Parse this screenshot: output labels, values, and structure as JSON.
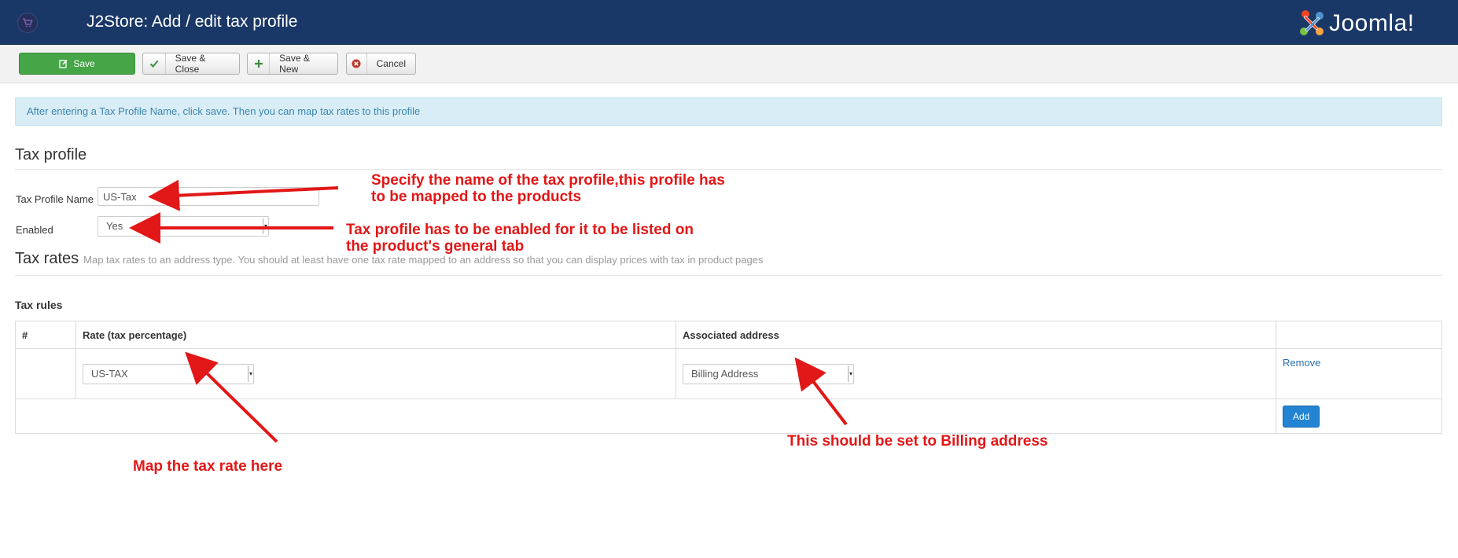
{
  "header": {
    "title": "J2Store: Add / edit tax profile",
    "brand": "Joomla!",
    "colors": {
      "background": "#1a3867",
      "text": "#ffffff"
    }
  },
  "toolbar": {
    "save_label": "Save",
    "save_close_label": "Save & Close",
    "save_new_label": "Save & New",
    "cancel_label": "Cancel"
  },
  "alert": {
    "text": "After entering a Tax Profile Name, click save. Then you can map tax rates to this profile"
  },
  "tax_profile": {
    "section_title": "Tax profile",
    "name_label": "Tax Profile Name",
    "name_value": "US-Tax",
    "enabled_label": "Enabled",
    "enabled_value": "Yes"
  },
  "tax_rates": {
    "section_title": "Tax rates",
    "description": "Map tax rates to an address type. You should at least have one tax rate mapped to an address so that you can display prices with tax in product pages"
  },
  "tax_rules": {
    "title": "Tax rules",
    "columns": [
      "#",
      "Rate (tax percentage)",
      "Associated address",
      ""
    ],
    "rows": [
      {
        "index": "",
        "rate": "US-TAX",
        "address": "Billing Address",
        "action": "Remove"
      }
    ],
    "add_label": "Add"
  },
  "annotations": {
    "name_note_1": "Specify the name of the tax profile,this profile has",
    "name_note_2": "to be mapped to the products",
    "enabled_note_1": "Tax profile has to be enabled for it to be listed on",
    "enabled_note_2": "the product's general tab",
    "rate_note": "Map the tax rate here",
    "address_note": "This should be set to Billing address",
    "color": "#e21717"
  }
}
